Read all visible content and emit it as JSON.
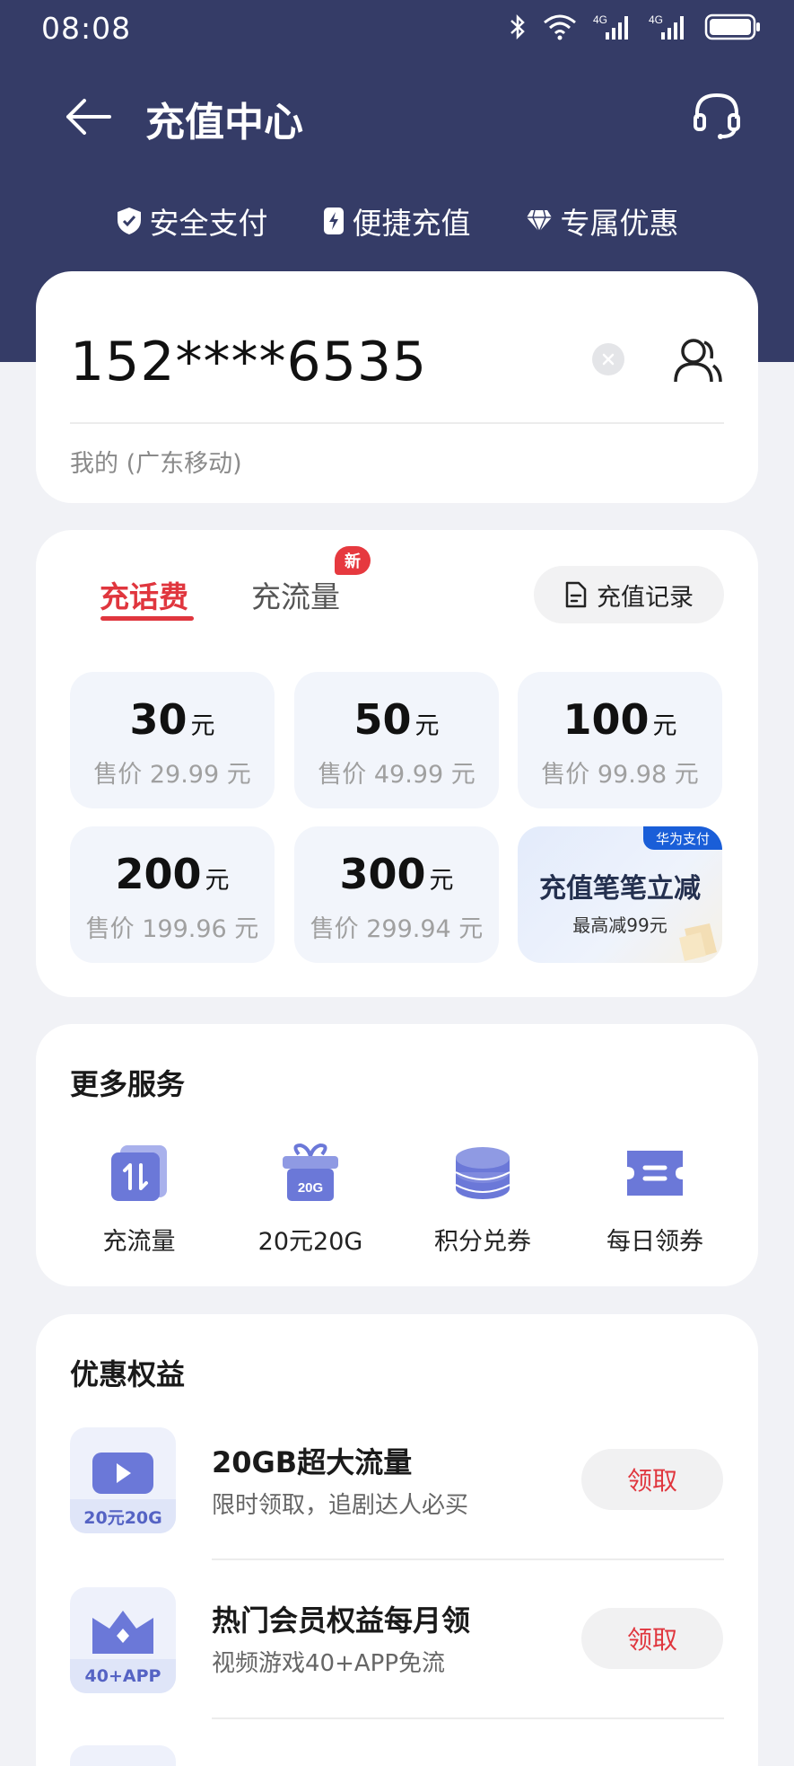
{
  "status_bar": {
    "time": "08:08",
    "net1": "4G",
    "net2": "4G"
  },
  "header": {
    "title": "充值中心"
  },
  "features": [
    {
      "label": "安全支付",
      "icon": "shield-check-icon"
    },
    {
      "label": "便捷充值",
      "icon": "bolt-card-icon"
    },
    {
      "label": "专属优惠",
      "icon": "diamond-icon"
    }
  ],
  "phone": {
    "number": "152****6535",
    "carrier": "我的 (广东移动)"
  },
  "recharge": {
    "tabs": {
      "fee": "充话费",
      "data": "充流量",
      "new_badge": "新"
    },
    "record_label": "充值记录",
    "options": [
      {
        "amount": "30",
        "unit": "元",
        "price": "售价 29.99 元"
      },
      {
        "amount": "50",
        "unit": "元",
        "price": "售价 49.99 元"
      },
      {
        "amount": "100",
        "unit": "元",
        "price": "售价 99.98 元"
      },
      {
        "amount": "200",
        "unit": "元",
        "price": "售价 199.96 元"
      },
      {
        "amount": "300",
        "unit": "元",
        "price": "售价 299.94 元"
      }
    ],
    "promo": {
      "tag": "华为支付",
      "title": "充值笔笔立减",
      "subtitle": "最高减99元"
    }
  },
  "services": {
    "title": "更多服务",
    "items": [
      {
        "label": "充流量",
        "icon": "data-transfer-icon"
      },
      {
        "label": "20元20G",
        "icon": "gift-box-icon",
        "icon_text": "20G"
      },
      {
        "label": "积分兑券",
        "icon": "coin-stack-icon"
      },
      {
        "label": "每日领券",
        "icon": "ticket-icon"
      }
    ]
  },
  "benefits": {
    "title": "优惠权益",
    "items": [
      {
        "title": "20GB超大流量",
        "subtitle": "限时领取，追剧达人必买",
        "badge": "20元20G",
        "button": "领取",
        "icon": "video-play-icon"
      },
      {
        "title": "热门会员权益每月领",
        "subtitle": "视频游戏40+APP免流",
        "badge": "40+APP",
        "button": "领取",
        "icon": "crown-icon"
      }
    ]
  },
  "colors": {
    "header_bg": "#353c67",
    "accent_red": "#e0363e",
    "icon_blue": "#6b78d8"
  }
}
